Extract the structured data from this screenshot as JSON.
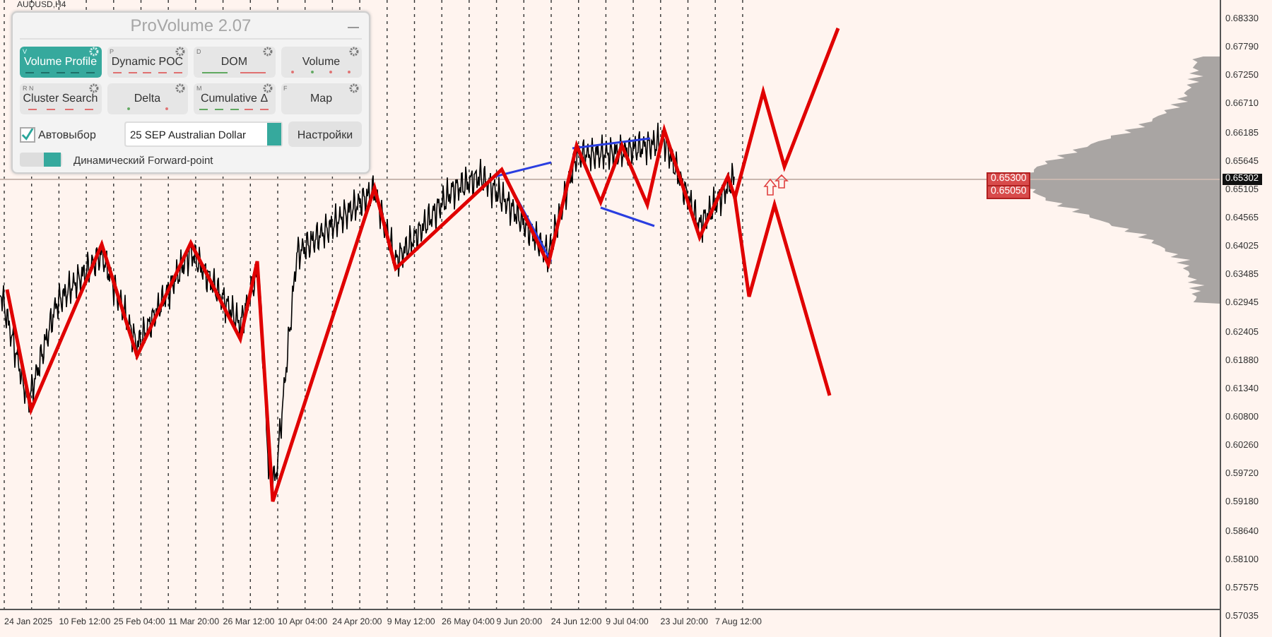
{
  "chart": {
    "symbol": "AUDUSD,H4",
    "price_scale": [
      "0.68330",
      "0.67790",
      "0.67250",
      "0.66710",
      "0.66185",
      "0.65645",
      "0.65105",
      "0.64565",
      "0.64025",
      "0.63485",
      "0.62945",
      "0.62405",
      "0.61880",
      "0.61340",
      "0.60800",
      "0.60260",
      "0.59720",
      "0.59180",
      "0.58640",
      "0.58100",
      "0.57575",
      "0.57035"
    ],
    "current_price": "0.65302",
    "level_labels": [
      "0.65300",
      "0.65050"
    ],
    "time_scale": [
      "24 Jan 2025",
      "10 Feb 12:00",
      "25 Feb 04:00",
      "11 Mar 20:00",
      "26 Mar 12:00",
      "10 Apr 04:00",
      "24 Apr 20:00",
      "9 May 12:00",
      "26 May 04:00",
      "9 Jun 20:00",
      "24 Jun 12:00",
      "9 Jul 04:00",
      "23 Jul 20:00",
      "7 Aug 12:00"
    ]
  },
  "panel": {
    "title": "ProVolume 2.07",
    "modes": [
      {
        "label": "Volume Profile",
        "hotkey": "V",
        "selected": true,
        "marks": [
          {
            "kind": "dash",
            "color": "#1e6f68"
          },
          {
            "kind": "dash",
            "color": "#1e6f68"
          },
          {
            "kind": "dash",
            "color": "#1e6f68"
          },
          {
            "kind": "dash",
            "color": "#1e6f68"
          },
          {
            "kind": "dash",
            "color": "#1e6f68"
          }
        ]
      },
      {
        "label": "Dynamic POC",
        "hotkey": "P",
        "selected": false,
        "marks": [
          {
            "kind": "dash",
            "color": "#e07070"
          },
          {
            "kind": "dash",
            "color": "#e07070"
          },
          {
            "kind": "dash",
            "color": "#e07070"
          },
          {
            "kind": "dash",
            "color": "#e07070"
          },
          {
            "kind": "dash",
            "color": "#e07070"
          }
        ]
      },
      {
        "label": "DOM",
        "hotkey": "D",
        "selected": false,
        "marks": [
          {
            "kind": "line",
            "color": "#60a860"
          },
          {
            "kind": "line",
            "color": "#e07070"
          }
        ]
      },
      {
        "label": "Volume",
        "selected": false,
        "marks": [
          {
            "kind": "dot",
            "color": "#e07070"
          },
          {
            "kind": "dot",
            "color": "#60a860"
          },
          {
            "kind": "dot",
            "color": "#e07070"
          },
          {
            "kind": "dot",
            "color": "#e07070"
          }
        ]
      },
      {
        "label": "Cluster Search",
        "hotkey": "R N",
        "selected": false,
        "marks": [
          {
            "kind": "dash",
            "color": "#e07070"
          },
          {
            "kind": "dash",
            "color": "#e07070"
          },
          {
            "kind": "dash",
            "color": "#e07070"
          },
          {
            "kind": "dash",
            "color": "#e07070"
          }
        ]
      },
      {
        "label": "Delta",
        "selected": false,
        "marks": [
          {
            "kind": "dot",
            "color": "#60a860"
          },
          {
            "kind": "dot",
            "color": "#e07070"
          }
        ]
      },
      {
        "label": "Cumulative Δ",
        "hotkey": "M",
        "selected": false,
        "marks": [
          {
            "kind": "dash",
            "color": "#60a860"
          },
          {
            "kind": "dash",
            "color": "#60a860"
          },
          {
            "kind": "dash",
            "color": "#60a860"
          },
          {
            "kind": "dash",
            "color": "#e07070"
          },
          {
            "kind": "dash",
            "color": "#e07070"
          }
        ]
      },
      {
        "label": "Map",
        "hotkey": "F",
        "selected": false
      }
    ],
    "auto_select": {
      "label": "Автовыбор",
      "checked": true
    },
    "instrument": {
      "value": "25 SEP Australian Dollar"
    },
    "settings_button": "Настройки",
    "forward_point": {
      "label": "Динамический Forward-point",
      "on": true
    }
  }
}
